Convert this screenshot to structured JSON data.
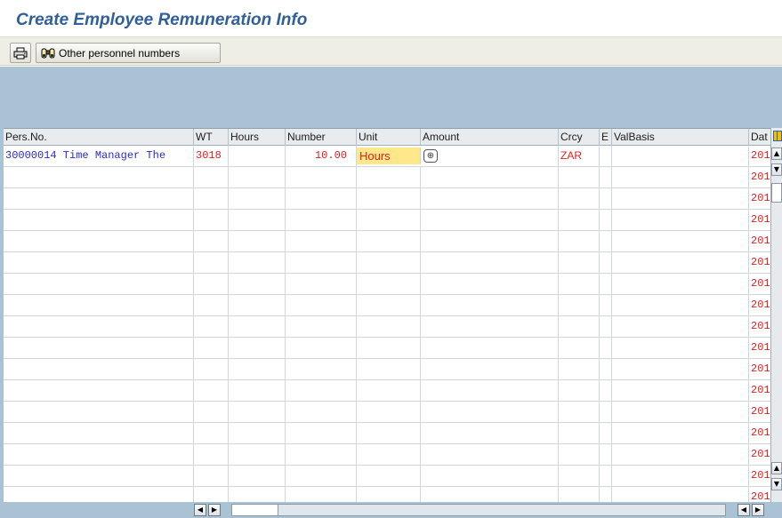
{
  "title": "Create Employee Remuneration Info",
  "toolbar": {
    "print_icon": "printer-icon",
    "other_icon": "binoculars-icon",
    "other_label": "Other personnel numbers"
  },
  "table": {
    "headers": {
      "pers": "Pers.No.",
      "wt": "WT",
      "hours": "Hours",
      "number": "Number",
      "unit": "Unit",
      "amount": "Amount",
      "crcy": "Crcy",
      "e": "E",
      "valbasis": "ValBasis",
      "date": "Dat"
    },
    "first_row": {
      "pers": "30000014 Time Manager The",
      "wt": "3018",
      "hours": "",
      "number": "10.00",
      "unit": "Hours",
      "amount_icon": "value-help-icon",
      "crcy": "ZAR",
      "e": "",
      "valbasis": "",
      "date": "201"
    },
    "empty_row_date": "201",
    "row_count": 17
  },
  "colors": {
    "title": "#2f5f9a",
    "background_band": "#a9c3d5",
    "required_field": "#e02020",
    "highlight": "#ffe88a",
    "link_text": "#2b2bd0"
  }
}
